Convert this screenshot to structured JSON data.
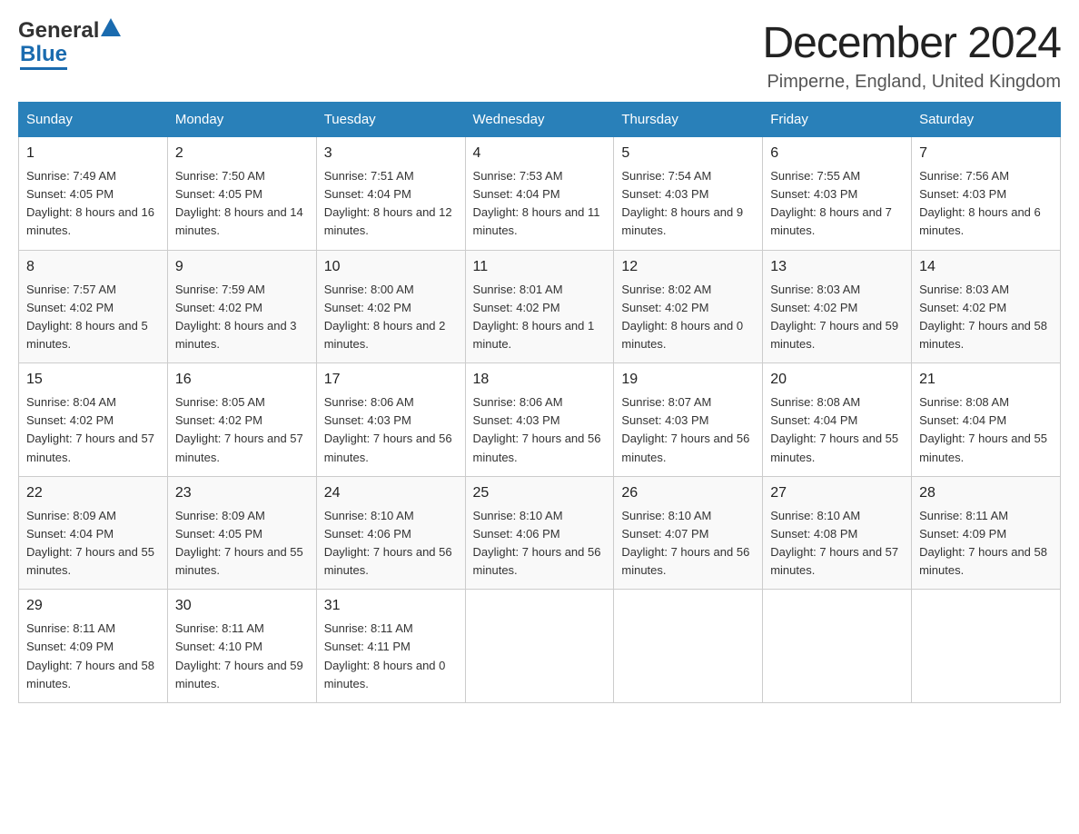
{
  "logo": {
    "general": "General",
    "blue": "Blue",
    "triangle_color": "#1a6baf"
  },
  "header": {
    "title": "December 2024",
    "subtitle": "Pimperne, England, United Kingdom"
  },
  "days_of_week": [
    "Sunday",
    "Monday",
    "Tuesday",
    "Wednesday",
    "Thursday",
    "Friday",
    "Saturday"
  ],
  "weeks": [
    [
      {
        "day": "1",
        "sunrise": "7:49 AM",
        "sunset": "4:05 PM",
        "daylight": "8 hours and 16 minutes."
      },
      {
        "day": "2",
        "sunrise": "7:50 AM",
        "sunset": "4:05 PM",
        "daylight": "8 hours and 14 minutes."
      },
      {
        "day": "3",
        "sunrise": "7:51 AM",
        "sunset": "4:04 PM",
        "daylight": "8 hours and 12 minutes."
      },
      {
        "day": "4",
        "sunrise": "7:53 AM",
        "sunset": "4:04 PM",
        "daylight": "8 hours and 11 minutes."
      },
      {
        "day": "5",
        "sunrise": "7:54 AM",
        "sunset": "4:03 PM",
        "daylight": "8 hours and 9 minutes."
      },
      {
        "day": "6",
        "sunrise": "7:55 AM",
        "sunset": "4:03 PM",
        "daylight": "8 hours and 7 minutes."
      },
      {
        "day": "7",
        "sunrise": "7:56 AM",
        "sunset": "4:03 PM",
        "daylight": "8 hours and 6 minutes."
      }
    ],
    [
      {
        "day": "8",
        "sunrise": "7:57 AM",
        "sunset": "4:02 PM",
        "daylight": "8 hours and 5 minutes."
      },
      {
        "day": "9",
        "sunrise": "7:59 AM",
        "sunset": "4:02 PM",
        "daylight": "8 hours and 3 minutes."
      },
      {
        "day": "10",
        "sunrise": "8:00 AM",
        "sunset": "4:02 PM",
        "daylight": "8 hours and 2 minutes."
      },
      {
        "day": "11",
        "sunrise": "8:01 AM",
        "sunset": "4:02 PM",
        "daylight": "8 hours and 1 minute."
      },
      {
        "day": "12",
        "sunrise": "8:02 AM",
        "sunset": "4:02 PM",
        "daylight": "8 hours and 0 minutes."
      },
      {
        "day": "13",
        "sunrise": "8:03 AM",
        "sunset": "4:02 PM",
        "daylight": "7 hours and 59 minutes."
      },
      {
        "day": "14",
        "sunrise": "8:03 AM",
        "sunset": "4:02 PM",
        "daylight": "7 hours and 58 minutes."
      }
    ],
    [
      {
        "day": "15",
        "sunrise": "8:04 AM",
        "sunset": "4:02 PM",
        "daylight": "7 hours and 57 minutes."
      },
      {
        "day": "16",
        "sunrise": "8:05 AM",
        "sunset": "4:02 PM",
        "daylight": "7 hours and 57 minutes."
      },
      {
        "day": "17",
        "sunrise": "8:06 AM",
        "sunset": "4:03 PM",
        "daylight": "7 hours and 56 minutes."
      },
      {
        "day": "18",
        "sunrise": "8:06 AM",
        "sunset": "4:03 PM",
        "daylight": "7 hours and 56 minutes."
      },
      {
        "day": "19",
        "sunrise": "8:07 AM",
        "sunset": "4:03 PM",
        "daylight": "7 hours and 56 minutes."
      },
      {
        "day": "20",
        "sunrise": "8:08 AM",
        "sunset": "4:04 PM",
        "daylight": "7 hours and 55 minutes."
      },
      {
        "day": "21",
        "sunrise": "8:08 AM",
        "sunset": "4:04 PM",
        "daylight": "7 hours and 55 minutes."
      }
    ],
    [
      {
        "day": "22",
        "sunrise": "8:09 AM",
        "sunset": "4:04 PM",
        "daylight": "7 hours and 55 minutes."
      },
      {
        "day": "23",
        "sunrise": "8:09 AM",
        "sunset": "4:05 PM",
        "daylight": "7 hours and 55 minutes."
      },
      {
        "day": "24",
        "sunrise": "8:10 AM",
        "sunset": "4:06 PM",
        "daylight": "7 hours and 56 minutes."
      },
      {
        "day": "25",
        "sunrise": "8:10 AM",
        "sunset": "4:06 PM",
        "daylight": "7 hours and 56 minutes."
      },
      {
        "day": "26",
        "sunrise": "8:10 AM",
        "sunset": "4:07 PM",
        "daylight": "7 hours and 56 minutes."
      },
      {
        "day": "27",
        "sunrise": "8:10 AM",
        "sunset": "4:08 PM",
        "daylight": "7 hours and 57 minutes."
      },
      {
        "day": "28",
        "sunrise": "8:11 AM",
        "sunset": "4:09 PM",
        "daylight": "7 hours and 58 minutes."
      }
    ],
    [
      {
        "day": "29",
        "sunrise": "8:11 AM",
        "sunset": "4:09 PM",
        "daylight": "7 hours and 58 minutes."
      },
      {
        "day": "30",
        "sunrise": "8:11 AM",
        "sunset": "4:10 PM",
        "daylight": "7 hours and 59 minutes."
      },
      {
        "day": "31",
        "sunrise": "8:11 AM",
        "sunset": "4:11 PM",
        "daylight": "8 hours and 0 minutes."
      },
      null,
      null,
      null,
      null
    ]
  ]
}
